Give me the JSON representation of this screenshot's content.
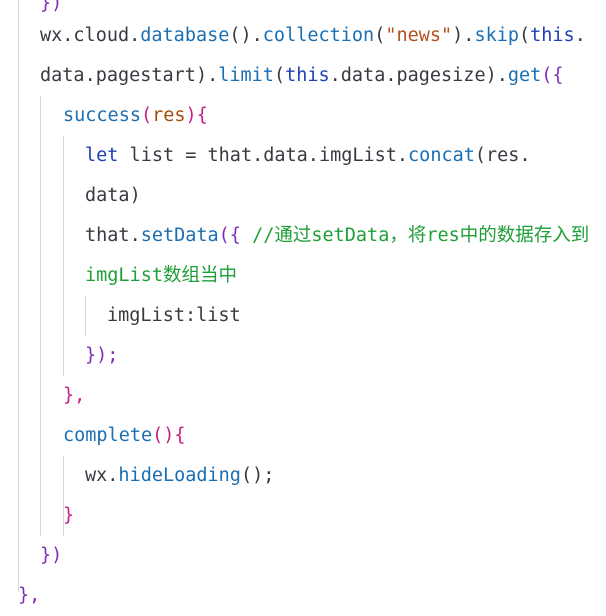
{
  "editor": {
    "lines": [
      {
        "tokens": [
          {
            "text": "})",
            "cls": "brace1"
          }
        ]
      },
      {
        "tokens": [
          {
            "text": "wx",
            "cls": "plain"
          },
          {
            "text": ".",
            "cls": "plain"
          },
          {
            "text": "cloud",
            "cls": "plain"
          },
          {
            "text": ".",
            "cls": "plain"
          },
          {
            "text": "database",
            "cls": "fn"
          },
          {
            "text": "().",
            "cls": "plain"
          },
          {
            "text": "collection",
            "cls": "fn"
          },
          {
            "text": "(",
            "cls": "plain"
          },
          {
            "text": "\"news\"",
            "cls": "str"
          },
          {
            "text": ").",
            "cls": "plain"
          },
          {
            "text": "skip",
            "cls": "fn"
          },
          {
            "text": "(",
            "cls": "plain"
          },
          {
            "text": "this",
            "cls": "kw"
          },
          {
            "text": ".",
            "cls": "plain"
          }
        ]
      },
      {
        "tokens": [
          {
            "text": "data",
            "cls": "plain"
          },
          {
            "text": ".",
            "cls": "plain"
          },
          {
            "text": "pagestart",
            "cls": "plain"
          },
          {
            "text": ").",
            "cls": "plain"
          },
          {
            "text": "limit",
            "cls": "fn"
          },
          {
            "text": "(",
            "cls": "plain"
          },
          {
            "text": "this",
            "cls": "kw"
          },
          {
            "text": ".",
            "cls": "plain"
          },
          {
            "text": "data",
            "cls": "plain"
          },
          {
            "text": ".",
            "cls": "plain"
          },
          {
            "text": "pagesize",
            "cls": "plain"
          },
          {
            "text": ").",
            "cls": "plain"
          },
          {
            "text": "get",
            "cls": "fn"
          },
          {
            "text": "({",
            "cls": "brace1"
          }
        ]
      },
      {
        "tokens": [
          {
            "text": "success",
            "cls": "fn"
          },
          {
            "text": "(",
            "cls": "brace3"
          },
          {
            "text": "res",
            "cls": "param"
          },
          {
            "text": "){",
            "cls": "brace3"
          }
        ]
      },
      {
        "tokens": [
          {
            "text": "let",
            "cls": "kw"
          },
          {
            "text": " list ",
            "cls": "plain"
          },
          {
            "text": "=",
            "cls": "plain"
          },
          {
            "text": " that",
            "cls": "plain"
          },
          {
            "text": ".",
            "cls": "plain"
          },
          {
            "text": "data",
            "cls": "plain"
          },
          {
            "text": ".",
            "cls": "plain"
          },
          {
            "text": "imgList",
            "cls": "plain"
          },
          {
            "text": ".",
            "cls": "plain"
          },
          {
            "text": "concat",
            "cls": "fn"
          },
          {
            "text": "(",
            "cls": "plain"
          },
          {
            "text": "res",
            "cls": "plain"
          },
          {
            "text": ".",
            "cls": "plain"
          }
        ]
      },
      {
        "tokens": [
          {
            "text": "data",
            "cls": "plain"
          },
          {
            "text": ")",
            "cls": "plain"
          }
        ]
      },
      {
        "tokens": [
          {
            "text": "that",
            "cls": "plain"
          },
          {
            "text": ".",
            "cls": "plain"
          },
          {
            "text": "setData",
            "cls": "fn"
          },
          {
            "text": "({",
            "cls": "brace1"
          },
          {
            "text": " //通过setData，将res中的数据存入到",
            "cls": "comment"
          }
        ]
      },
      {
        "tokens": [
          {
            "text": "imgList数组当中",
            "cls": "comment"
          }
        ]
      },
      {
        "tokens": [
          {
            "text": "imgList",
            "cls": "brace2"
          },
          {
            "text": ":",
            "cls": "plain"
          },
          {
            "text": "list",
            "cls": "plain"
          }
        ]
      },
      {
        "tokens": [
          {
            "text": "});",
            "cls": "brace1"
          }
        ]
      },
      {
        "tokens": [
          {
            "text": "},",
            "cls": "brace3"
          }
        ]
      },
      {
        "tokens": [
          {
            "text": "complete",
            "cls": "fn"
          },
          {
            "text": "(){",
            "cls": "brace3"
          }
        ]
      },
      {
        "tokens": [
          {
            "text": "wx",
            "cls": "plain"
          },
          {
            "text": ".",
            "cls": "plain"
          },
          {
            "text": "hideLoading",
            "cls": "fn"
          },
          {
            "text": "();",
            "cls": "plain"
          }
        ]
      },
      {
        "tokens": [
          {
            "text": "}",
            "cls": "brace3"
          }
        ]
      },
      {
        "tokens": [
          {
            "text": "})",
            "cls": "brace1"
          }
        ]
      },
      {
        "tokens": [
          {
            "text": "},",
            "cls": "brace1"
          }
        ]
      }
    ]
  }
}
